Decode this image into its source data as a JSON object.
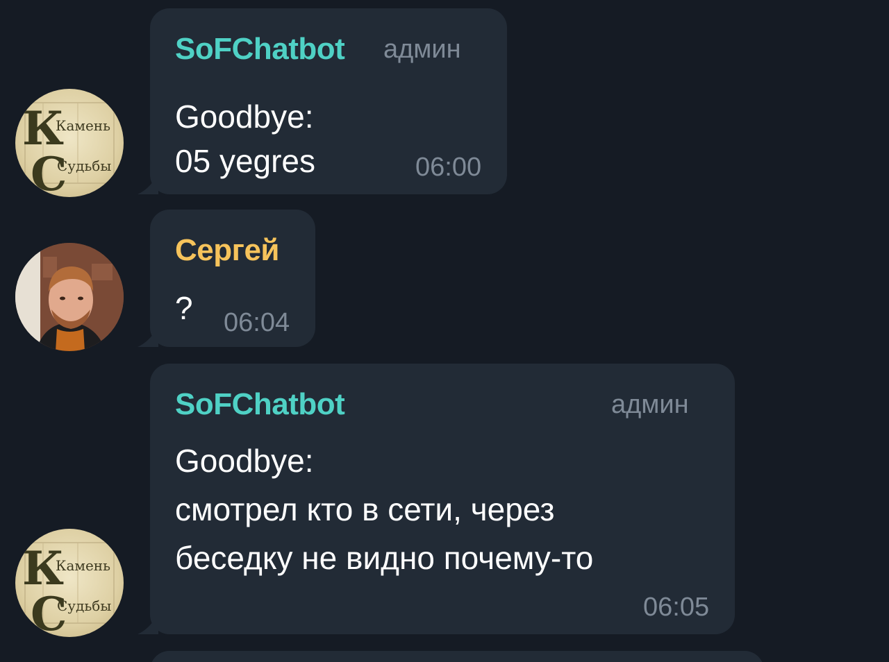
{
  "messages": [
    {
      "sender": "SoFChatbot",
      "role": "админ",
      "lines": [
        "Goodbye:",
        "05 yegres"
      ],
      "time": "06:00",
      "sender_color": "#4fd1c5",
      "avatar": "kamen-sudby-logo",
      "avatar_text": [
        "Камень",
        "Судьбы"
      ]
    },
    {
      "sender": "Сергей",
      "lines": [
        "?"
      ],
      "time": "06:04",
      "sender_color": "#f6c35b",
      "avatar": "user-photo"
    },
    {
      "sender": "SoFChatbot",
      "role": "админ",
      "lines": [
        "Goodbye:",
        "смотрел кто в сети, через",
        "беседку не видно почему-то"
      ],
      "time": "06:05",
      "sender_color": "#4fd1c5",
      "avatar": "kamen-sudby-logo",
      "avatar_text": [
        "Камень",
        "Судьбы"
      ]
    }
  ],
  "colors": {
    "background": "#151b24",
    "bubble": "#222b36",
    "meta": "#7f8a97",
    "text": "#ffffff"
  }
}
